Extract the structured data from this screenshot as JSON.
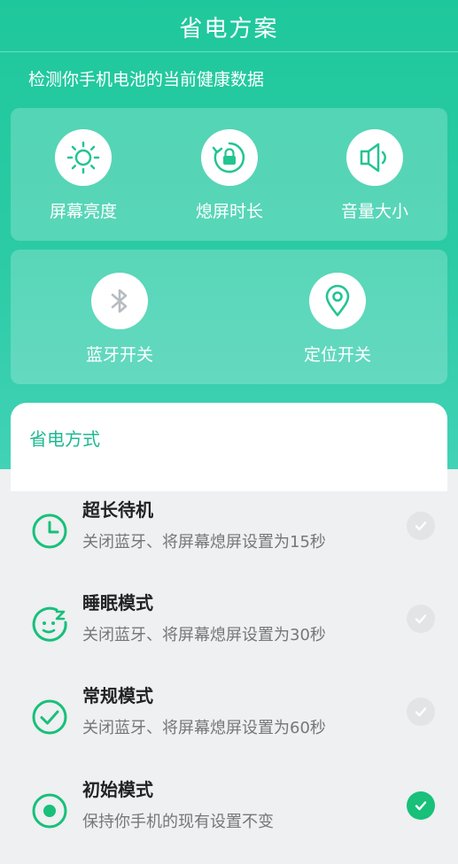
{
  "header": {
    "title": "省电方案",
    "subtitle": "检测你手机电池的当前健康数据"
  },
  "tools_row1": [
    {
      "label": "屏幕亮度",
      "icon": "sun-icon"
    },
    {
      "label": "熄屏时长",
      "icon": "screen-lock-icon"
    },
    {
      "label": "音量大小",
      "icon": "speaker-icon"
    }
  ],
  "tools_row2": [
    {
      "label": "蓝牙开关",
      "icon": "bluetooth-icon"
    },
    {
      "label": "定位开关",
      "icon": "location-pin-icon"
    }
  ],
  "section": {
    "title": "省电方式"
  },
  "modes": [
    {
      "name": "超长待机",
      "desc": "关闭蓝牙、将屏幕熄屏设置为15秒",
      "icon": "clock-icon",
      "selected": false
    },
    {
      "name": "睡眠模式",
      "desc": "关闭蓝牙、将屏幕熄屏设置为30秒",
      "icon": "sleep-face-icon",
      "selected": false
    },
    {
      "name": "常规模式",
      "desc": "关闭蓝牙、将屏幕熄屏设置为60秒",
      "icon": "check-circle-icon",
      "selected": false
    },
    {
      "name": "初始模式",
      "desc": "保持你手机的现有设置不变",
      "icon": "radio-dot-icon",
      "selected": true
    }
  ],
  "colors": {
    "accent": "#1fc89c",
    "selected": "#18c07a",
    "unselected": "#e2e4e6"
  }
}
